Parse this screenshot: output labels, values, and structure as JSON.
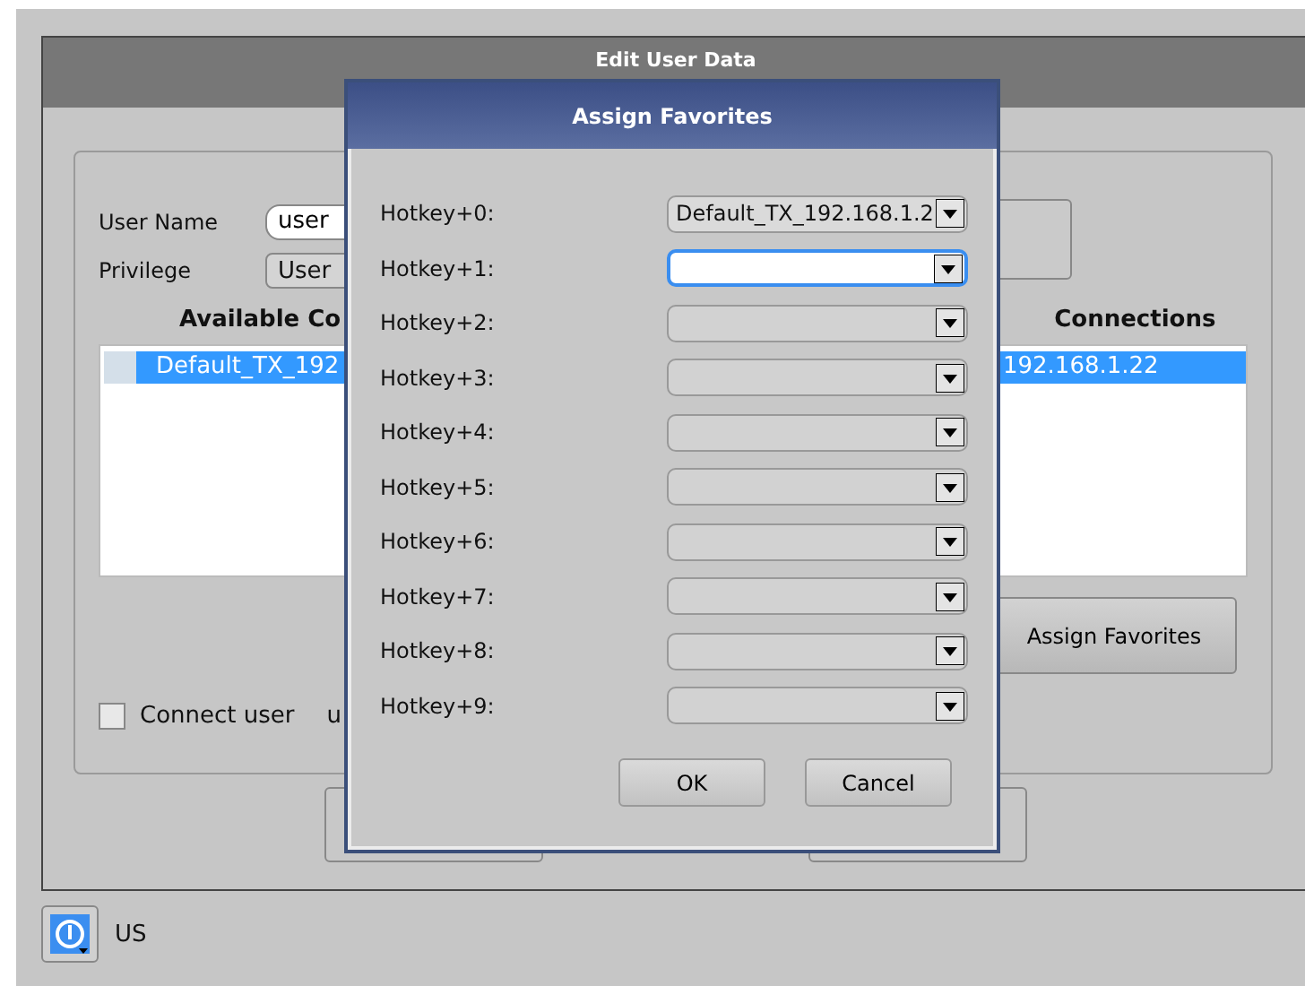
{
  "main_window": {
    "title": "Edit User Data",
    "user_name": {
      "label": "User Name",
      "value": "user"
    },
    "privilege": {
      "label": "Privilege",
      "value": "User"
    },
    "available": {
      "heading": "Available Co",
      "rows": [
        {
          "text": "Default_TX_192",
          "selected": true
        }
      ]
    },
    "assigned": {
      "heading": "Connections",
      "rows": [
        {
          "text": "192.168.1.22",
          "selected": true
        }
      ]
    },
    "assign_button": "Assign Favorites",
    "connect": {
      "label": "Connect user",
      "checked": false,
      "text_after": "u"
    }
  },
  "dialog": {
    "title": "Assign Favorites",
    "hotkeys": [
      {
        "label": "Hotkey+0:",
        "value": "Default_TX_192.168.1.2",
        "focused": false
      },
      {
        "label": "Hotkey+1:",
        "focused": true
      },
      {
        "label": "Hotkey+2:",
        "focused": false
      },
      {
        "label": "Hotkey+3:",
        "focused": false
      },
      {
        "label": "Hotkey+4:",
        "focused": false
      },
      {
        "label": "Hotkey+5:",
        "focused": false
      },
      {
        "label": "Hotkey+6:",
        "focused": false
      },
      {
        "label": "Hotkey+7:",
        "focused": false
      },
      {
        "label": "Hotkey+8:",
        "focused": false
      },
      {
        "label": "Hotkey+9:",
        "focused": false
      }
    ],
    "buttons": [
      "OK",
      "Cancel"
    ]
  },
  "status_bar": {
    "layout": "US"
  }
}
